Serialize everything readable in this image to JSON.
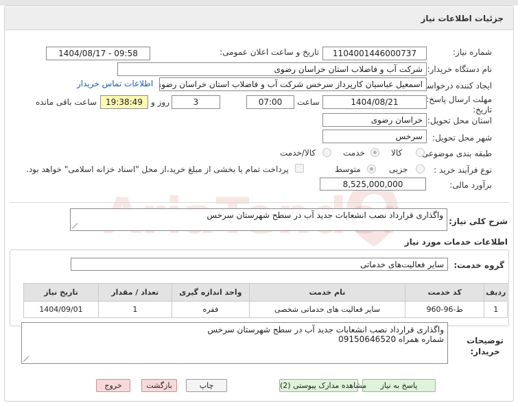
{
  "panel": {
    "title": "جزئیات اطلاعات نیاز"
  },
  "fields": {
    "need_number_label": "شماره نیاز:",
    "need_number": "1104001446000737",
    "announce_label": "تاریخ و ساعت اعلان عمومی:",
    "announce_value": "1404/08/17 - 09:58",
    "buyer_org_label": "نام دستگاه خریدار:",
    "buyer_org": "شرکت آب و فاضلاب استان خراسان رضوی",
    "creator_label": "ایجاد کننده درخواست:",
    "creator": "اسمعیل عباسیان کارپرداز سرخس  شرکت آب و فاضلاب استان خراسان رضوی",
    "contact_link": "اطلاعات تماس خریدار",
    "deadline_label": "مهلت ارسال پاسخ: تا تاریخ:",
    "deadline_date": "1404/08/21",
    "hour_label": "ساعت",
    "deadline_time": "07:00",
    "days_value": "3",
    "days_label": "روز و",
    "remaining_time": "19:38:49",
    "remaining_label": "ساعت باقی مانده",
    "province_label": "استان محل تحویل:",
    "province": "خراسان رضوی",
    "city_label": "شهر محل تحویل:",
    "city": "سرخس",
    "category_label": "طبقه بندی موضوعی:",
    "category_options": [
      "کالا",
      "خدمت",
      "کالا/خدمت"
    ],
    "category_selected": "خدمت",
    "process_label": "نوع فرآیند خرید :",
    "process_options": [
      "جزیی",
      "متوسط"
    ],
    "process_selected": "متوسط",
    "payment_note": "پرداخت تمام یا بخشی از مبلغ خرید،از محل \"اسناد خزانه اسلامی\" خواهد بود.",
    "estimate_label": "برآورد مالی:",
    "estimate": "8,525,000,000"
  },
  "summary": {
    "label": "شرح کلی نیاز:",
    "value": "واگذاری قرارداد نصب انشعابات جدید آب در سطح شهرستان سرخس"
  },
  "services": {
    "section_title": "اطلاعات خدمات مورد نیاز",
    "group_label": "گروه خدمت:",
    "group_value": "سایر فعالیت‌های خدماتی",
    "table": {
      "headers": [
        "ردیف",
        "کد خدمت",
        "نام خدمت",
        "واحد اندازه گیری",
        "تعداد / مقدار",
        "تاریخ نیاز"
      ],
      "rows": [
        [
          "1",
          "ط-96-960",
          "سایر فعالیت های خدماتی شخصی",
          "فقره",
          "1",
          "1404/09/01"
        ]
      ]
    }
  },
  "buyer_notes": {
    "label": "توضیحات خریدار:",
    "line1": "واگذاری قرارداد نصب انشعابات جدید آب در سطح شهرستان سرخس",
    "line2": "شماره همراه 09150646520"
  },
  "buttons": {
    "reply": "پاسخ به نیاز",
    "attachments": "مشاهده مدارک پیوستی (2)",
    "print": "چاپ",
    "back": "بازگشت",
    "exit": "خروج"
  },
  "watermark": {
    "text": "AriaTender.net"
  },
  "colors": {
    "header_bg": "#eeeeee",
    "link": "#1a5fb4",
    "remaining_bg": "#fbfbb4",
    "button_green": "#dff2da",
    "button_pink": "#f7d9d9"
  }
}
